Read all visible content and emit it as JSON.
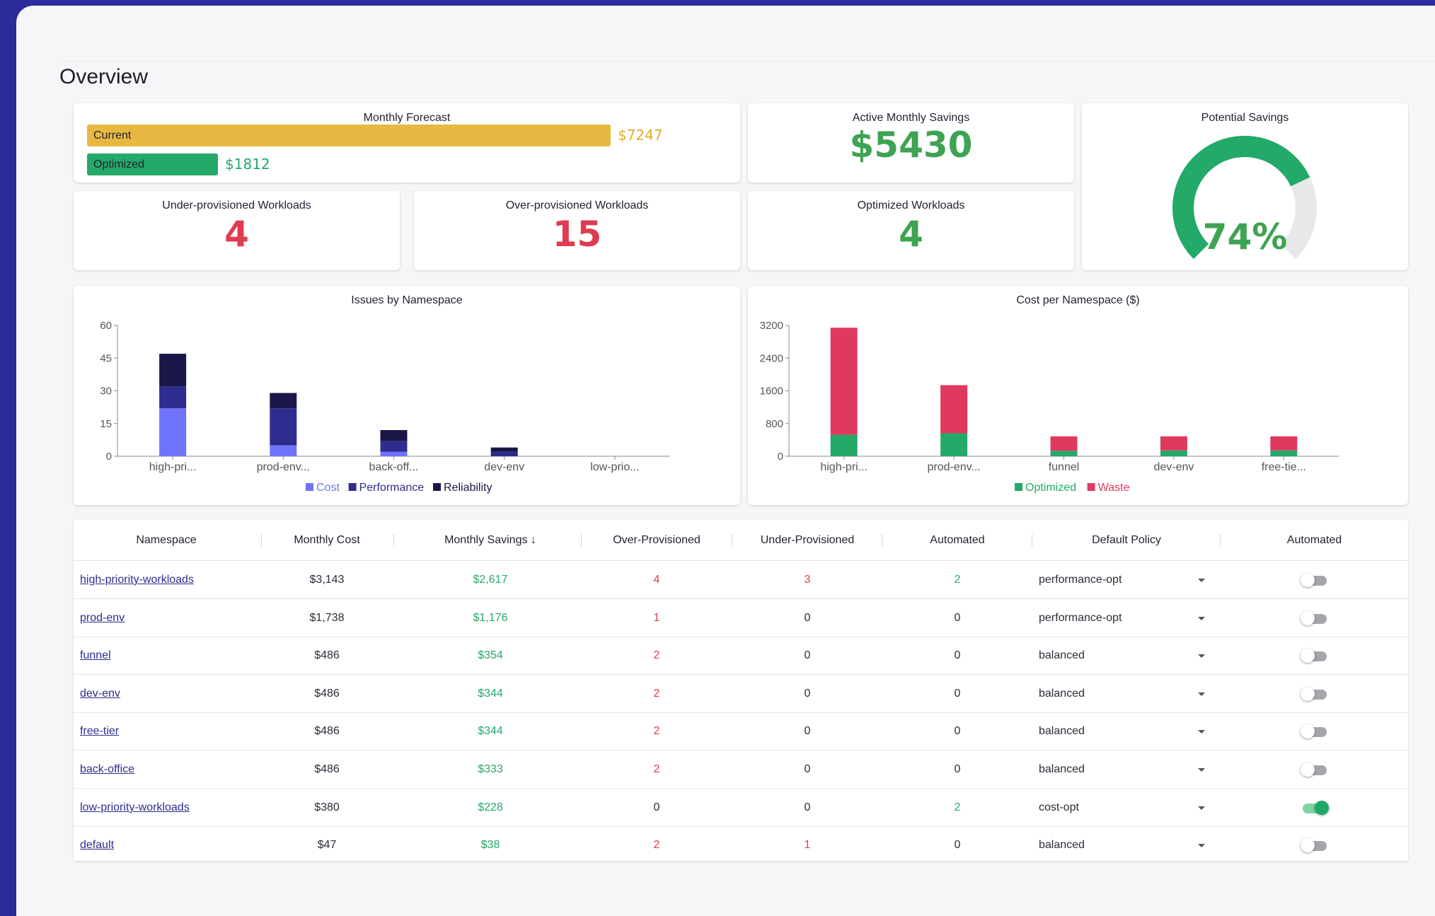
{
  "page_title": "Overview",
  "colors": {
    "green": "#23a968",
    "red": "#e03b51",
    "yellow": "#e8b843",
    "navy": "#1a1748",
    "indigo": "#2f2c8f",
    "periwinkle": "#6f74fa",
    "crimson": "#e0395f"
  },
  "forecast": {
    "title": "Monthly Forecast",
    "current_label": "Current",
    "current_value": "$7247",
    "current_amount": 7247,
    "optimized_label": "Optimized",
    "optimized_value": "$1812",
    "optimized_amount": 1812
  },
  "active_savings": {
    "title": "Active Monthly Savings",
    "value": "$5430"
  },
  "potential_savings": {
    "title": "Potential Savings",
    "value": "74%",
    "fraction": 0.74
  },
  "under_provisioned": {
    "title": "Under-provisioned Workloads",
    "value": "4"
  },
  "over_provisioned": {
    "title": "Over-provisioned Workloads",
    "value": "15"
  },
  "optimized_workloads": {
    "title": "Optimized Workloads",
    "value": "4"
  },
  "chart_data": [
    {
      "type": "bar",
      "stacked": true,
      "title": "Issues by Namespace",
      "categories": [
        "high-pri...",
        "prod-env...",
        "back-off...",
        "dev-env",
        "low-prio..."
      ],
      "series": [
        {
          "name": "Cost",
          "color": "#6f74fa",
          "values": [
            22,
            5,
            2,
            0,
            0
          ]
        },
        {
          "name": "Performance",
          "color": "#2f2c8f",
          "values": [
            10,
            17,
            5,
            2,
            0
          ]
        },
        {
          "name": "Reliability",
          "color": "#1a1748",
          "values": [
            15,
            7,
            5,
            2,
            0
          ]
        }
      ],
      "yticks": [
        0,
        15,
        30,
        45,
        60
      ],
      "ylim": [
        0,
        60
      ],
      "grid": false,
      "legend": "bottom"
    },
    {
      "type": "bar",
      "stacked": true,
      "title": "Cost per Namespace ($)",
      "categories": [
        "high-pri...",
        "prod-env...",
        "funnel",
        "dev-env",
        "free-tie..."
      ],
      "series": [
        {
          "name": "Optimized",
          "color": "#23a968",
          "values": [
            526,
            562,
            132,
            142,
            142
          ]
        },
        {
          "name": "Waste",
          "color": "#e0395f",
          "values": [
            2617,
            1176,
            354,
            344,
            344
          ]
        }
      ],
      "yticks": [
        0,
        800,
        1600,
        2400,
        3200
      ],
      "ylim": [
        0,
        3200
      ],
      "grid": false,
      "legend": "bottom"
    }
  ],
  "table": {
    "headers": [
      "Namespace",
      "Monthly Cost",
      "Monthly Savings ↓",
      "Over-Provisioned",
      "Under-Provisioned",
      "Automated",
      "Default Policy",
      "Automated"
    ],
    "rows": [
      {
        "namespace": "high-priority-workloads",
        "cost": "$3,143",
        "savings": "$2,617",
        "over": "4",
        "under": "3",
        "automated": "2",
        "policy": "performance-opt",
        "toggle": false
      },
      {
        "namespace": "prod-env",
        "cost": "$1,738",
        "savings": "$1,176",
        "over": "1",
        "under": "0",
        "automated": "0",
        "policy": "performance-opt",
        "toggle": false
      },
      {
        "namespace": "funnel",
        "cost": "$486",
        "savings": "$354",
        "over": "2",
        "under": "0",
        "automated": "0",
        "policy": "balanced",
        "toggle": false
      },
      {
        "namespace": "dev-env",
        "cost": "$486",
        "savings": "$344",
        "over": "2",
        "under": "0",
        "automated": "0",
        "policy": "balanced",
        "toggle": false
      },
      {
        "namespace": "free-tier",
        "cost": "$486",
        "savings": "$344",
        "over": "2",
        "under": "0",
        "automated": "0",
        "policy": "balanced",
        "toggle": false
      },
      {
        "namespace": "back-office",
        "cost": "$486",
        "savings": "$333",
        "over": "2",
        "under": "0",
        "automated": "0",
        "policy": "balanced",
        "toggle": false
      },
      {
        "namespace": "low-priority-workloads",
        "cost": "$380",
        "savings": "$228",
        "over": "0",
        "under": "0",
        "automated": "2",
        "policy": "cost-opt",
        "toggle": true
      },
      {
        "namespace": "default",
        "cost": "$47",
        "savings": "$38",
        "over": "2",
        "under": "1",
        "automated": "0",
        "policy": "balanced",
        "toggle": false
      }
    ]
  }
}
